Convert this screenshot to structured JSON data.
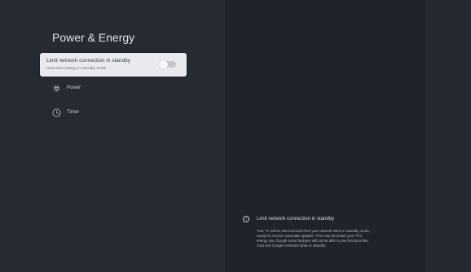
{
  "page": {
    "title": "Power & Energy"
  },
  "setting": {
    "title": "Limit network connection in standby",
    "subtitle": "Uses less energy in standby mode",
    "toggle_on": false
  },
  "menu": {
    "items": [
      {
        "label": "Power",
        "icon": "power-plug-icon"
      },
      {
        "label": "Timer",
        "icon": "timer-icon"
      }
    ]
  },
  "info": {
    "icon": "info-icon",
    "title": "Limit network connection in standby",
    "body": "Your TV will be disconnected from your network when in standby mode, except to receive automatic updates. This may decrease your TV's energy use, though some features will not be able to use functions like Cast and Google Assistant while in standby."
  },
  "colors": {
    "background": "#1d2128",
    "left_panel": "#262a33",
    "card": "#e8eaed",
    "text_light": "#dfe2e7"
  }
}
